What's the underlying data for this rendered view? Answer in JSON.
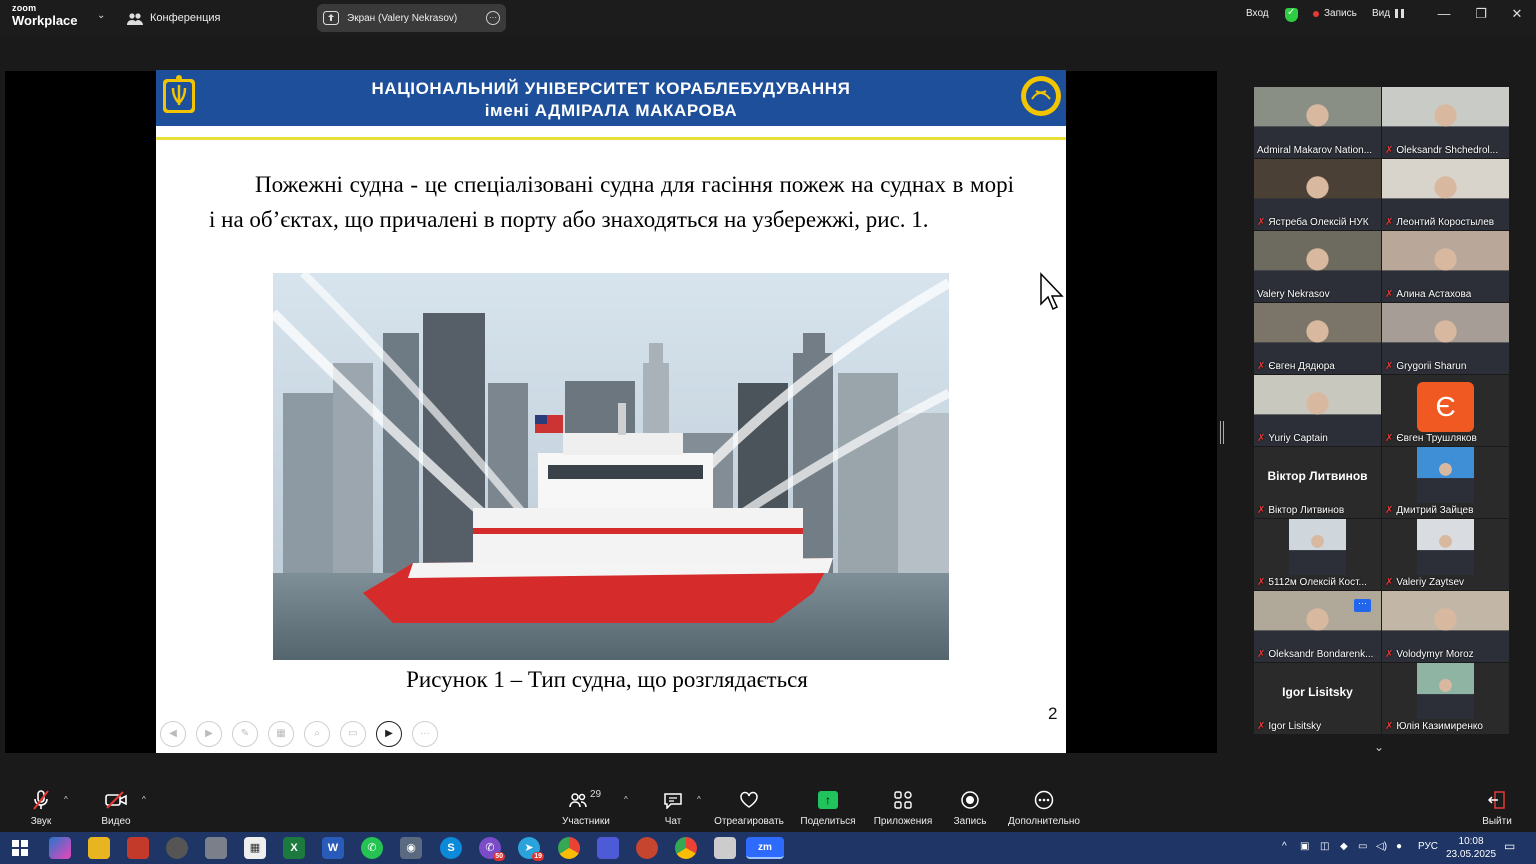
{
  "titlebar": {
    "brand_top": "zoom",
    "brand_bottom": "Workplace",
    "meeting_label": "Конференция",
    "share_label": "Экран (Valery Nekrasov)",
    "signin": "Вход",
    "record_label": "Запись",
    "view_label": "Вид"
  },
  "slide": {
    "header_line1": "НАЦІОНАЛЬНИЙ УНІВЕРСИТЕТ КОРАБЛЕБУДУВАННЯ",
    "header_line2": "імені АДМІРАЛА МАКАРОВА",
    "body": "Пожежні судна - це спеціалізовані судна для гасіння пожеж на суднах в морі і на об’єктах, що причалені в порту або знаходяться на узбережжі, рис. 1.",
    "caption": "Рисунок 1 –  Тип судна, що розглядається",
    "page_number": "2"
  },
  "participants": [
    {
      "name": "Admiral Makarov Nation...",
      "muted": false,
      "kind": "video",
      "tone": "#8a8f86"
    },
    {
      "name": "Oleksandr Shchedrol...",
      "muted": true,
      "kind": "video",
      "tone": "#c8cbc6"
    },
    {
      "name": "Ястреба Олексій НУК",
      "muted": true,
      "kind": "video",
      "tone": "#4a4036"
    },
    {
      "name": "Леонтий Коростылев",
      "muted": true,
      "kind": "video",
      "tone": "#d8d4cc"
    },
    {
      "name": "Valery Nekrasov",
      "muted": false,
      "kind": "video",
      "tone": "#6d6a5f",
      "speaking": true
    },
    {
      "name": "Алина Астахова",
      "muted": true,
      "kind": "video",
      "tone": "#b9a89a"
    },
    {
      "name": "Євген Дядюра",
      "muted": true,
      "kind": "video",
      "tone": "#7b7468"
    },
    {
      "name": "Grygorii Sharun",
      "muted": true,
      "kind": "video",
      "tone": "#a69e96"
    },
    {
      "name": "Yuriy Captain",
      "muted": true,
      "kind": "video",
      "tone": "#c9c8be"
    },
    {
      "name": "Євген Трушляков",
      "muted": true,
      "kind": "avatar",
      "initial": "Є"
    },
    {
      "name": "Віктор Литвинов",
      "muted": true,
      "kind": "name"
    },
    {
      "name": "Дмитрий Зайцев",
      "muted": true,
      "kind": "photo",
      "tone": "#3f8fd6"
    },
    {
      "name": "5112м  Олексій Кост...",
      "muted": true,
      "kind": "photo",
      "tone": "#cfd7dd"
    },
    {
      "name": "Valeriy Zaytsev",
      "muted": true,
      "kind": "photo",
      "tone": "#d9dde1"
    },
    {
      "name": "Oleksandr Bondarenk...",
      "muted": true,
      "kind": "video",
      "tone": "#b0a898",
      "more": true
    },
    {
      "name": "Volodymyr Moroz",
      "muted": true,
      "kind": "video",
      "tone": "#c2b7a6"
    },
    {
      "name": "Igor Lisitsky",
      "muted": true,
      "kind": "name"
    },
    {
      "name": "Юлія Казимиренко",
      "muted": true,
      "kind": "photo",
      "tone": "#8fb4a4"
    }
  ],
  "toolbar": {
    "audio": "Звук",
    "video": "Видео",
    "participants": "Участники",
    "participants_count": "29",
    "chat": "Чат",
    "react": "Отреагировать",
    "share": "Поделиться",
    "apps": "Приложения",
    "record": "Запись",
    "more": "Дополнительно",
    "leave": "Выйти"
  },
  "taskbar": {
    "badge_viber": "50",
    "badge_telegram": "19",
    "lang": "РУС",
    "time": "10:08",
    "date": "23.05.2025"
  }
}
